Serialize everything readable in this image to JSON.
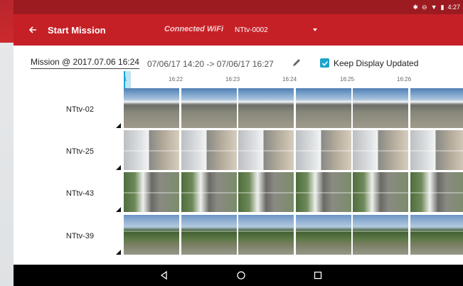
{
  "status_bar": {
    "time": "4:27",
    "icons": [
      "bluetooth-icon",
      "minus-circle-icon",
      "wifi-icon",
      "battery-icon"
    ]
  },
  "app_bar": {
    "back_icon": "arrow-left-icon",
    "title": "Start Mission",
    "wifi_label": "Connected WiFi",
    "wifi_value": "NTtv-0002"
  },
  "controls": {
    "mission_name": "Mission @ 2017.07.06 16:24",
    "mission_range": "07/06/17 14:20 -> 07/06/17 16:27",
    "edit_icon": "pencil-icon",
    "keep_updated_checked": true,
    "keep_updated_label": "Keep Display Updated"
  },
  "timeline": {
    "cursor_label": "1",
    "ticks": [
      "16:22",
      "16:23",
      "16:24",
      "16:25",
      "16:26"
    ]
  },
  "rows": [
    {
      "label": "NTtv-02"
    },
    {
      "label": "NTtv-25"
    },
    {
      "label": "NTtv-43"
    },
    {
      "label": "NTtv-39"
    }
  ],
  "nav_bar": {
    "back_icon": "triangle-back-icon",
    "home_icon": "circle-home-icon",
    "recents_icon": "square-recents-icon"
  },
  "colors": {
    "app_bar": "#c62027",
    "status_bar": "#9c1b20",
    "accent": "#1ba5c9"
  }
}
